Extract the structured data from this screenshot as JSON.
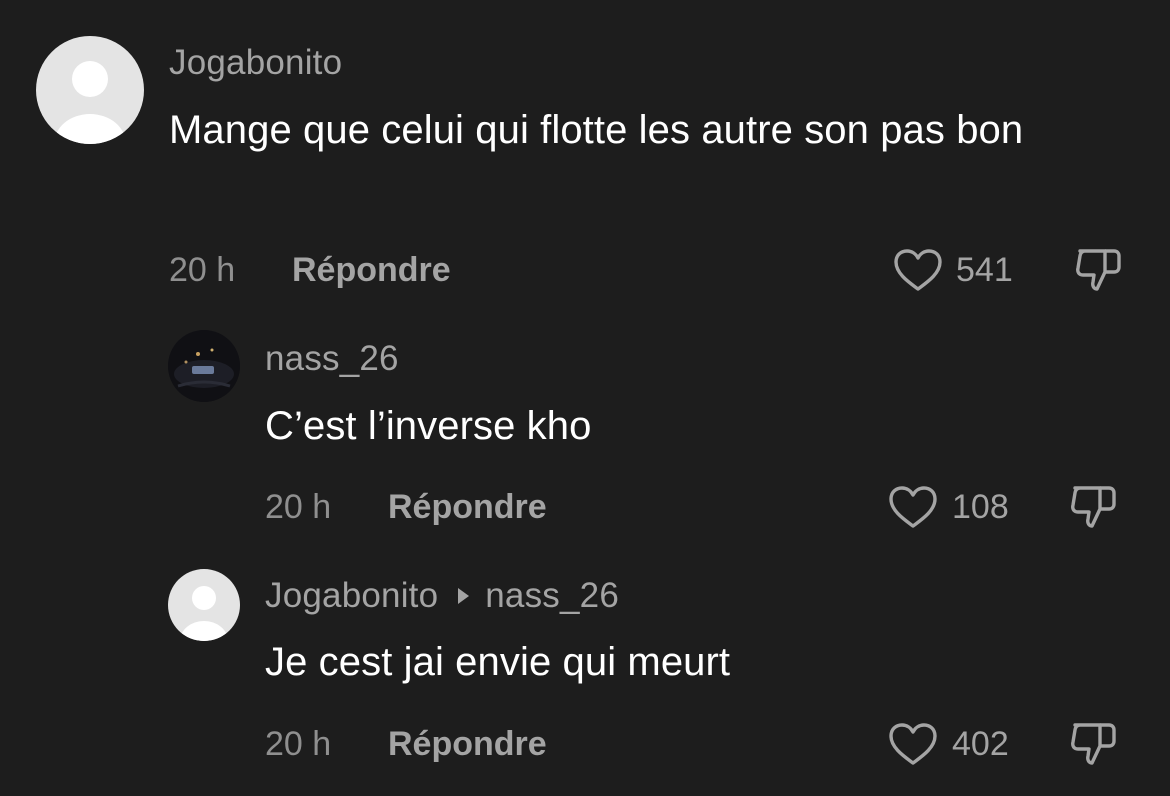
{
  "comments": [
    {
      "username": "Jogabonito",
      "reply_to": "",
      "text": "Mange que celui qui flotte les autre son pas bon",
      "time": "20 h",
      "reply_label": "Répondre",
      "likes": "541",
      "avatar": "default-avatar-icon"
    },
    {
      "username": "nass_26",
      "reply_to": "",
      "text": "C’est l’inverse kho",
      "time": "20 h",
      "reply_label": "Répondre",
      "likes": "108",
      "avatar": "photo-avatar"
    },
    {
      "username": "Jogabonito",
      "reply_to": "nass_26",
      "text": "Je cest jai envie qui meurt",
      "time": "20 h",
      "reply_label": "Répondre",
      "likes": "402",
      "avatar": "default-avatar-icon"
    }
  ],
  "icons": {
    "like": "heart-outline-icon",
    "dislike": "thumbs-down-outline-icon",
    "reply_arrow": "caret-right-icon"
  },
  "colors": {
    "background": "#1d1d1d",
    "username": "#a4a4a4",
    "text": "#ffffff",
    "meta": "#8f8f8f"
  }
}
